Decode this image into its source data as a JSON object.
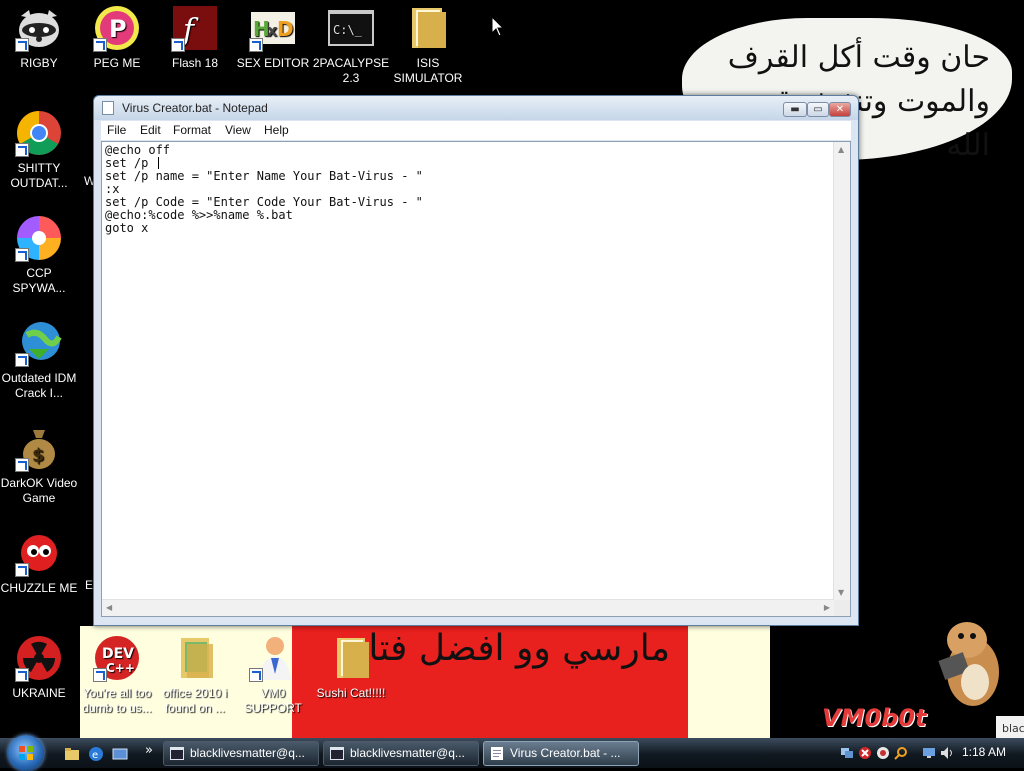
{
  "wallpaper": {
    "bubble_text": "حان وقت أكل القرف والموت وتنفيذ وقت الله",
    "banner_text": "مارسي وو افضل فتاة",
    "brand": "VM0b0t",
    "peek_text": "blac"
  },
  "desktop_icons": [
    {
      "label": "RIGBY",
      "icon": "raccoon-icon"
    },
    {
      "label": "PEG ME",
      "icon": "peg-icon"
    },
    {
      "label": "Flash 18",
      "icon": "flash-icon"
    },
    {
      "label": "SEX EDITOR",
      "icon": "hex-editor-icon"
    },
    {
      "label": "2PACALYPSE 2.3",
      "icon": "console-icon"
    },
    {
      "label": "ISIS SIMULATOR",
      "icon": "folder-icon"
    },
    {
      "label": "SHITTY OUTDAT...",
      "icon": "chrome-icon"
    },
    {
      "label": "CCP SPYWA...",
      "icon": "pinwheel-icon"
    },
    {
      "label": "Outdated IDM Crack I...",
      "icon": "globe-download-icon"
    },
    {
      "label": "DarkOK Video Game",
      "icon": "money-bag-icon"
    },
    {
      "label": "CHUZZLE ME",
      "icon": "chuzzle-icon"
    },
    {
      "label": "UKRAINE",
      "icon": "radiation-icon"
    },
    {
      "label": "You're all too dumb to us...",
      "icon": "devcpp-icon"
    },
    {
      "label": "office 2010 i found on ...",
      "icon": "folder-icon"
    },
    {
      "label": "VM0 SUPPORT",
      "icon": "support-person-icon"
    },
    {
      "label": "Sushi Cat!!!!!",
      "icon": "folder-icon"
    }
  ],
  "partial_labels": {
    "w": "W",
    "e": "E"
  },
  "notepad": {
    "title": "Virus Creator.bat - Notepad",
    "menu": [
      "File",
      "Edit",
      "Format",
      "View",
      "Help"
    ],
    "lines": [
      "@echo off",
      "set /p ",
      "set /p name = \"Enter Name Your Bat-Virus - \"",
      ":x",
      "set /p Code = \"Enter Code Your Bat-Virus - \"",
      "@echo:%code %>>%name %.bat",
      "goto x"
    ],
    "caret_line": 1,
    "buttons": {
      "minimize": "▬",
      "maximize": "▭",
      "close": "✕"
    }
  },
  "taskbar": {
    "quick_launch_chevron": "»",
    "tasks": [
      {
        "label": "blacklivesmatter@q...",
        "active": false
      },
      {
        "label": "blacklivesmatter@q...",
        "active": false
      },
      {
        "label": "Virus Creator.bat - ...",
        "active": true
      }
    ],
    "clock": "1:18 AM"
  },
  "colors": {
    "accent_red": "#e8201e",
    "banner_yellow": "#ffffe0",
    "taskbar": "#101820"
  }
}
